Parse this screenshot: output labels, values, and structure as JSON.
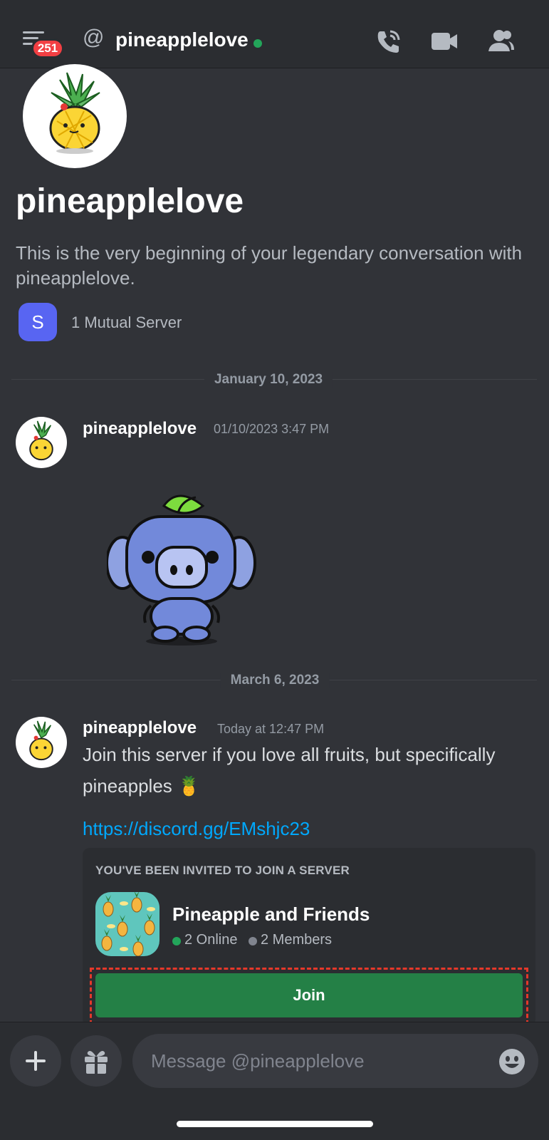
{
  "header": {
    "notification_count": "251",
    "at_symbol": "@",
    "username": "pineapplelove",
    "status_color": "#23a55a",
    "icons": [
      "menu-icon",
      "voice-call-icon",
      "video-call-icon",
      "members-icon"
    ]
  },
  "profile": {
    "name": "pineapplelove",
    "intro": "This is the very beginning of your legendary conversation with pineapplelove.",
    "mutual_server_initial": "S",
    "mutual_servers": "1 Mutual Server"
  },
  "dividers": {
    "first": "January 10, 2023",
    "second": "March 6, 2023"
  },
  "messages": [
    {
      "author": "pineapplelove",
      "timestamp": "01/10/2023 3:47 PM",
      "sticker": "wumpus-sticker"
    },
    {
      "author": "pineapplelove",
      "timestamp": "Today at 12:47 PM",
      "text": "Join this server if you love all fruits, but specifically pineapples 🍍",
      "link": "https://discord.gg/EMshjc23"
    }
  ],
  "invite": {
    "heading": "YOU'VE BEEN INVITED TO JOIN A SERVER",
    "server_name": "Pineapple and Friends",
    "online": "2 Online",
    "members": "2 Members",
    "join_label": "Join",
    "join_color": "#248046"
  },
  "composer": {
    "placeholder": "Message @pineapplelove"
  }
}
